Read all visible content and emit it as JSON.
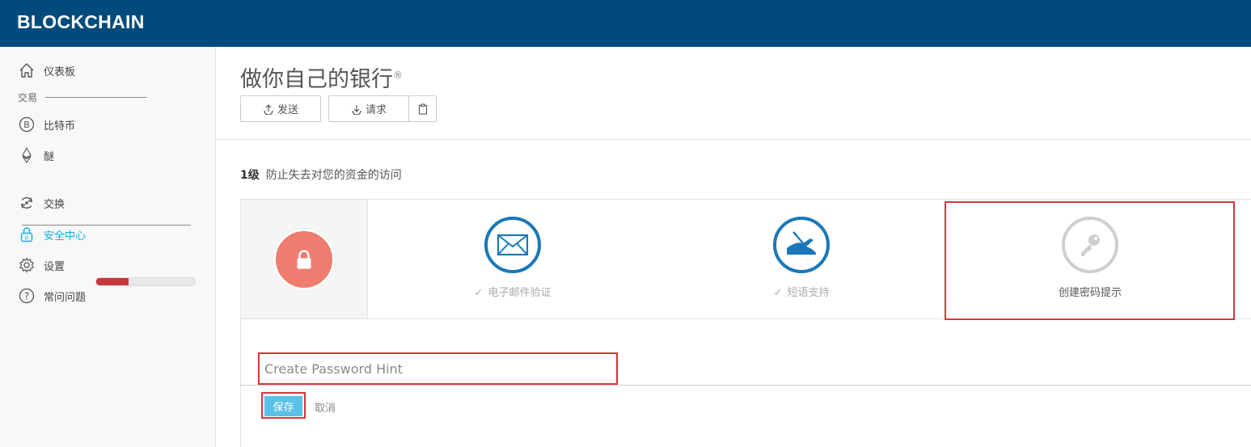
{
  "app": {
    "logo": "BLOCKCHAIN"
  },
  "sidebar": {
    "dashboard": "仪表板",
    "section_label": "交易",
    "bitcoin": "比特币",
    "ether": "醚",
    "exchange": "交换",
    "security": "安全中心",
    "security_progress_fraction": 0.33,
    "settings": "设置",
    "faq": "常问问题"
  },
  "header": {
    "title": "做你自己的银行",
    "title_mark": "®",
    "send_label": "发送",
    "request_label": "请求"
  },
  "security": {
    "level": "1级",
    "level_desc": "防止失去对您的资金的访问",
    "steps": [
      {
        "label": "电子邮件验证",
        "check": "✓",
        "icon": "envelope-icon"
      },
      {
        "label": "短语支持",
        "check": "✓",
        "icon": "writing-hand-icon"
      },
      {
        "label": "创建密码提示",
        "icon": "key-icon"
      }
    ],
    "hint_placeholder": "Create Password Hint",
    "save_label": "保存",
    "cancel_label": "取消"
  },
  "colors": {
    "topbar": "#004a7c",
    "accent": "#10ade4",
    "danger": "#c8353a",
    "step_blue": "#1a78b8",
    "lock_coral": "#ee7d6f",
    "highlight": "#d9363a"
  }
}
